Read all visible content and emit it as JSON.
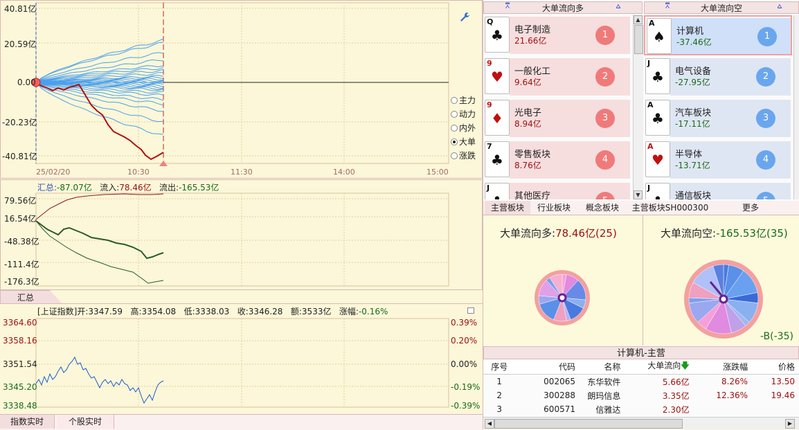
{
  "main_chart": {
    "y_labels": [
      "40.81亿",
      "20.59亿",
      "0.00",
      "-20.23亿",
      "-40.81亿"
    ],
    "x_labels": [
      "25/02/20",
      "10:30",
      "11:30",
      "14:00",
      "15:00"
    ],
    "options": [
      "主力",
      "动力",
      "内外",
      "大单",
      "涨跌"
    ],
    "selected_option": "大单",
    "settings_icon": "wrench-icon"
  },
  "flow_chart": {
    "summary_label": "汇总:",
    "summary_value": "-87.07亿",
    "inflow_label": "流入:",
    "inflow_value": "78.46亿",
    "outflow_label": "流出:",
    "outflow_value": "-165.53亿",
    "y_labels": [
      "79.56亿",
      "16.54亿",
      "-48.38亿",
      "-111.4亿",
      "-176.3亿"
    ],
    "tab": "汇总"
  },
  "index_chart": {
    "name": "[上证指数]",
    "open_label": "开:",
    "open": "3347.59",
    "high_label": "高:",
    "high": "3354.08",
    "low_label": "低:",
    "low": "3338.03",
    "close_label": "收:",
    "close": "3346.28",
    "amount_label": "额:",
    "amount": "3533亿",
    "change_label": "涨幅:",
    "change": "-0.16%",
    "y_labels": [
      "3364.60",
      "3358.16",
      "3351.54",
      "3345.20",
      "3338.48"
    ],
    "pct_labels": [
      "0.39%",
      "0.20%",
      "0.00%",
      "-0.19%",
      "-0.39%"
    ],
    "tabs": [
      "指数实时",
      "个股实时"
    ]
  },
  "inflow_list": {
    "title": "大单流向多",
    "items": [
      {
        "card": "Q",
        "suit": "♣",
        "name": "电子制造",
        "value": "21.66亿",
        "rank": "1"
      },
      {
        "card": "9",
        "suit": "♥",
        "name": "一般化工",
        "value": "9.64亿",
        "rank": "2"
      },
      {
        "card": "9",
        "suit": "♦",
        "name": "光电子",
        "value": "8.94亿",
        "rank": "3"
      },
      {
        "card": "7",
        "suit": "♣",
        "name": "零售板块",
        "value": "8.76亿",
        "rank": "4"
      },
      {
        "card": "J",
        "suit": "♣",
        "name": "其他医疗",
        "value": "",
        "rank": "5"
      }
    ]
  },
  "outflow_list": {
    "title": "大单流向空",
    "items": [
      {
        "card": "A",
        "suit": "♠",
        "name": "计算机",
        "value": "-37.46亿",
        "rank": "1"
      },
      {
        "card": "J",
        "suit": "♣",
        "name": "电气设备",
        "value": "-27.95亿",
        "rank": "2"
      },
      {
        "card": "A",
        "suit": "♣",
        "name": "汽车板块",
        "value": "-17.11亿",
        "rank": "3"
      },
      {
        "card": "A",
        "suit": "♥",
        "name": "半导体",
        "value": "-13.71亿",
        "rank": "4"
      },
      {
        "card": "J",
        "suit": "♣",
        "name": "通信板块",
        "value": "",
        "rank": "5"
      }
    ]
  },
  "sector_tabs": [
    "主营板块",
    "行业板块",
    "概念板块",
    "主营板块SH000300",
    "更多"
  ],
  "pies": {
    "long_label": "大单流向多:",
    "long_value": "78.46亿(25)",
    "short_label": "大单流向空:",
    "short_value": "-165.53亿(35)",
    "b_label": "-B(-35)"
  },
  "stock_table": {
    "title": "计算机-主营",
    "columns": [
      "序号",
      "代码",
      "名称",
      "大单流向",
      "涨跌幅",
      "价格"
    ],
    "sort_arrow": "arrow-down-icon",
    "rows": [
      {
        "no": "1",
        "code": "002065",
        "name": "东华软件",
        "flow": "5.66亿",
        "chg": "8.26%",
        "price": "13.50"
      },
      {
        "no": "2",
        "code": "300288",
        "name": "朗玛信息",
        "flow": "3.35亿",
        "chg": "12.36%",
        "price": "19.46"
      },
      {
        "no": "3",
        "code": "600571",
        "name": "信雅达",
        "flow": "2.30亿",
        "chg": "",
        "price": ""
      }
    ]
  }
}
